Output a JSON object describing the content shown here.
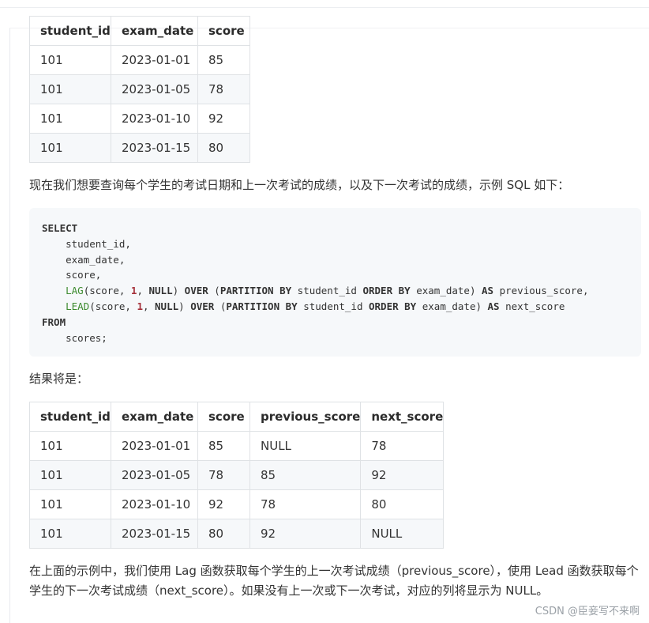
{
  "table1": {
    "headers": [
      "student_id",
      "exam_date",
      "score"
    ],
    "rows": [
      [
        "101",
        "2023-01-01",
        "85"
      ],
      [
        "101",
        "2023-01-05",
        "78"
      ],
      [
        "101",
        "2023-01-10",
        "92"
      ],
      [
        "101",
        "2023-01-15",
        "80"
      ]
    ]
  },
  "paragraph1": "现在我们想要查询每个学生的考试日期和上一次考试的成绩，以及下一次考试的成绩，示例 SQL 如下：",
  "code": {
    "lines": [
      [
        {
          "t": "SELECT",
          "c": "kw"
        }
      ],
      [
        {
          "t": "    student_id,",
          "c": ""
        }
      ],
      [
        {
          "t": "    exam_date,",
          "c": ""
        }
      ],
      [
        {
          "t": "    score,",
          "c": ""
        }
      ],
      [
        {
          "t": "    ",
          "c": ""
        },
        {
          "t": "LAG",
          "c": "fn"
        },
        {
          "t": "(score, ",
          "c": ""
        },
        {
          "t": "1",
          "c": "num"
        },
        {
          "t": ", ",
          "c": ""
        },
        {
          "t": "NULL",
          "c": "kw"
        },
        {
          "t": ") ",
          "c": ""
        },
        {
          "t": "OVER",
          "c": "kw"
        },
        {
          "t": " (",
          "c": ""
        },
        {
          "t": "PARTITION BY",
          "c": "kw"
        },
        {
          "t": " student_id ",
          "c": ""
        },
        {
          "t": "ORDER BY",
          "c": "kw"
        },
        {
          "t": " exam_date) ",
          "c": ""
        },
        {
          "t": "AS",
          "c": "kw"
        },
        {
          "t": " previous_score,",
          "c": ""
        }
      ],
      [
        {
          "t": "    ",
          "c": ""
        },
        {
          "t": "LEAD",
          "c": "fn"
        },
        {
          "t": "(score, ",
          "c": ""
        },
        {
          "t": "1",
          "c": "num"
        },
        {
          "t": ", ",
          "c": ""
        },
        {
          "t": "NULL",
          "c": "kw"
        },
        {
          "t": ") ",
          "c": ""
        },
        {
          "t": "OVER",
          "c": "kw"
        },
        {
          "t": " (",
          "c": ""
        },
        {
          "t": "PARTITION BY",
          "c": "kw"
        },
        {
          "t": " student_id ",
          "c": ""
        },
        {
          "t": "ORDER BY",
          "c": "kw"
        },
        {
          "t": " exam_date) ",
          "c": ""
        },
        {
          "t": "AS",
          "c": "kw"
        },
        {
          "t": " next_score",
          "c": ""
        }
      ],
      [
        {
          "t": "FROM",
          "c": "kw"
        }
      ],
      [
        {
          "t": "    scores;",
          "c": ""
        }
      ]
    ]
  },
  "paragraph2": "结果将是：",
  "table2": {
    "headers": [
      "student_id",
      "exam_date",
      "score",
      "previous_score",
      "next_score"
    ],
    "rows": [
      [
        "101",
        "2023-01-01",
        "85",
        "NULL",
        "78"
      ],
      [
        "101",
        "2023-01-05",
        "78",
        "85",
        "92"
      ],
      [
        "101",
        "2023-01-10",
        "92",
        "78",
        "80"
      ],
      [
        "101",
        "2023-01-15",
        "80",
        "92",
        "NULL"
      ]
    ]
  },
  "paragraph3": "在上面的示例中，我们使用 Lag 函数获取每个学生的上一次考试成绩（previous_score），使用 Lead 函数获取每个学生的下一次考试成绩（next_score）。如果没有上一次或下一次考试，对应的列将显示为 NULL。",
  "watermark": "CSDN @臣妾写不来啊"
}
